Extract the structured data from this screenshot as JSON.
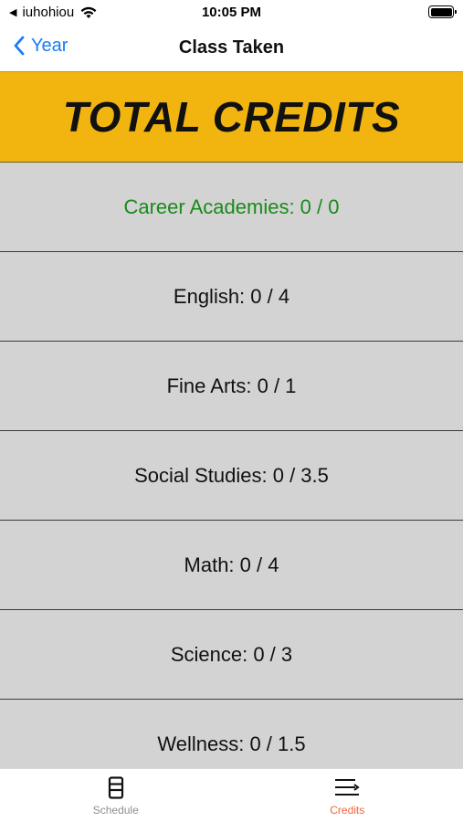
{
  "status_bar": {
    "carrier": "iuhohiou",
    "time": "10:05 PM"
  },
  "nav": {
    "back_label": "Year",
    "title": "Class Taken"
  },
  "header": {
    "title": "TOTAL CREDITS",
    "background": "#f2b510"
  },
  "credits": [
    {
      "label": "Career Academies: 0 / 0",
      "color": "#1a8a1a"
    },
    {
      "label": "English: 0 / 4"
    },
    {
      "label": "Fine Arts: 0 / 1"
    },
    {
      "label": "Social Studies: 0 / 3.5"
    },
    {
      "label": "Math: 0 / 4"
    },
    {
      "label": "Science: 0 / 3"
    },
    {
      "label": "Wellness: 0 / 1.5"
    }
  ],
  "tabs": [
    {
      "label": "Schedule",
      "icon": "schedule-icon",
      "active": false
    },
    {
      "label": "Credits",
      "icon": "credits-list-icon",
      "active": true
    }
  ],
  "colors": {
    "accent_blue": "#1a7cf2",
    "active_tab": "#f0643a",
    "row_background": "#d3d3d3"
  }
}
